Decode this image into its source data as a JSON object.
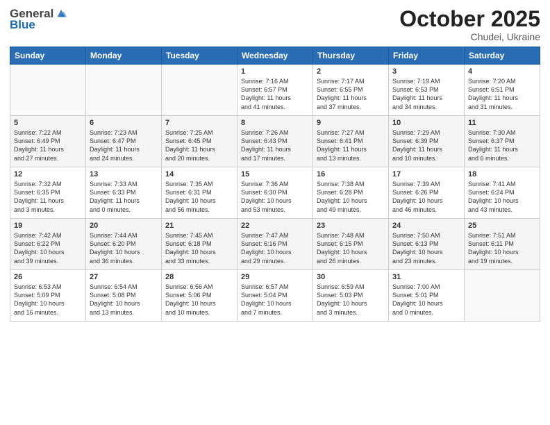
{
  "logo": {
    "general": "General",
    "blue": "Blue"
  },
  "title": "October 2025",
  "subtitle": "Chudei, Ukraine",
  "days_of_week": [
    "Sunday",
    "Monday",
    "Tuesday",
    "Wednesday",
    "Thursday",
    "Friday",
    "Saturday"
  ],
  "weeks": [
    [
      {
        "day": "",
        "info": ""
      },
      {
        "day": "",
        "info": ""
      },
      {
        "day": "",
        "info": ""
      },
      {
        "day": "1",
        "info": "Sunrise: 7:16 AM\nSunset: 6:57 PM\nDaylight: 11 hours\nand 41 minutes."
      },
      {
        "day": "2",
        "info": "Sunrise: 7:17 AM\nSunset: 6:55 PM\nDaylight: 11 hours\nand 37 minutes."
      },
      {
        "day": "3",
        "info": "Sunrise: 7:19 AM\nSunset: 6:53 PM\nDaylight: 11 hours\nand 34 minutes."
      },
      {
        "day": "4",
        "info": "Sunrise: 7:20 AM\nSunset: 6:51 PM\nDaylight: 11 hours\nand 31 minutes."
      }
    ],
    [
      {
        "day": "5",
        "info": "Sunrise: 7:22 AM\nSunset: 6:49 PM\nDaylight: 11 hours\nand 27 minutes."
      },
      {
        "day": "6",
        "info": "Sunrise: 7:23 AM\nSunset: 6:47 PM\nDaylight: 11 hours\nand 24 minutes."
      },
      {
        "day": "7",
        "info": "Sunrise: 7:25 AM\nSunset: 6:45 PM\nDaylight: 11 hours\nand 20 minutes."
      },
      {
        "day": "8",
        "info": "Sunrise: 7:26 AM\nSunset: 6:43 PM\nDaylight: 11 hours\nand 17 minutes."
      },
      {
        "day": "9",
        "info": "Sunrise: 7:27 AM\nSunset: 6:41 PM\nDaylight: 11 hours\nand 13 minutes."
      },
      {
        "day": "10",
        "info": "Sunrise: 7:29 AM\nSunset: 6:39 PM\nDaylight: 11 hours\nand 10 minutes."
      },
      {
        "day": "11",
        "info": "Sunrise: 7:30 AM\nSunset: 6:37 PM\nDaylight: 11 hours\nand 6 minutes."
      }
    ],
    [
      {
        "day": "12",
        "info": "Sunrise: 7:32 AM\nSunset: 6:35 PM\nDaylight: 11 hours\nand 3 minutes."
      },
      {
        "day": "13",
        "info": "Sunrise: 7:33 AM\nSunset: 6:33 PM\nDaylight: 11 hours\nand 0 minutes."
      },
      {
        "day": "14",
        "info": "Sunrise: 7:35 AM\nSunset: 6:31 PM\nDaylight: 10 hours\nand 56 minutes."
      },
      {
        "day": "15",
        "info": "Sunrise: 7:36 AM\nSunset: 6:30 PM\nDaylight: 10 hours\nand 53 minutes."
      },
      {
        "day": "16",
        "info": "Sunrise: 7:38 AM\nSunset: 6:28 PM\nDaylight: 10 hours\nand 49 minutes."
      },
      {
        "day": "17",
        "info": "Sunrise: 7:39 AM\nSunset: 6:26 PM\nDaylight: 10 hours\nand 46 minutes."
      },
      {
        "day": "18",
        "info": "Sunrise: 7:41 AM\nSunset: 6:24 PM\nDaylight: 10 hours\nand 43 minutes."
      }
    ],
    [
      {
        "day": "19",
        "info": "Sunrise: 7:42 AM\nSunset: 6:22 PM\nDaylight: 10 hours\nand 39 minutes."
      },
      {
        "day": "20",
        "info": "Sunrise: 7:44 AM\nSunset: 6:20 PM\nDaylight: 10 hours\nand 36 minutes."
      },
      {
        "day": "21",
        "info": "Sunrise: 7:45 AM\nSunset: 6:18 PM\nDaylight: 10 hours\nand 33 minutes."
      },
      {
        "day": "22",
        "info": "Sunrise: 7:47 AM\nSunset: 6:16 PM\nDaylight: 10 hours\nand 29 minutes."
      },
      {
        "day": "23",
        "info": "Sunrise: 7:48 AM\nSunset: 6:15 PM\nDaylight: 10 hours\nand 26 minutes."
      },
      {
        "day": "24",
        "info": "Sunrise: 7:50 AM\nSunset: 6:13 PM\nDaylight: 10 hours\nand 23 minutes."
      },
      {
        "day": "25",
        "info": "Sunrise: 7:51 AM\nSunset: 6:11 PM\nDaylight: 10 hours\nand 19 minutes."
      }
    ],
    [
      {
        "day": "26",
        "info": "Sunrise: 6:53 AM\nSunset: 5:09 PM\nDaylight: 10 hours\nand 16 minutes."
      },
      {
        "day": "27",
        "info": "Sunrise: 6:54 AM\nSunset: 5:08 PM\nDaylight: 10 hours\nand 13 minutes."
      },
      {
        "day": "28",
        "info": "Sunrise: 6:56 AM\nSunset: 5:06 PM\nDaylight: 10 hours\nand 10 minutes."
      },
      {
        "day": "29",
        "info": "Sunrise: 6:57 AM\nSunset: 5:04 PM\nDaylight: 10 hours\nand 7 minutes."
      },
      {
        "day": "30",
        "info": "Sunrise: 6:59 AM\nSunset: 5:03 PM\nDaylight: 10 hours\nand 3 minutes."
      },
      {
        "day": "31",
        "info": "Sunrise: 7:00 AM\nSunset: 5:01 PM\nDaylight: 10 hours\nand 0 minutes."
      },
      {
        "day": "",
        "info": ""
      }
    ]
  ]
}
